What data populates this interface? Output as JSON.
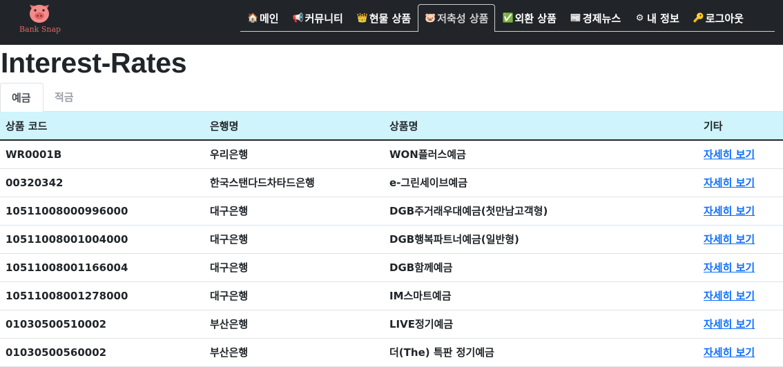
{
  "brand": {
    "name": "Bank Snap",
    "logo_icon": "pig-logo-icon",
    "accent": "#e06565"
  },
  "nav": {
    "items": [
      {
        "label": "메인",
        "icon": "house-icon",
        "active": false
      },
      {
        "label": "커뮤니티",
        "icon": "megaphone-icon",
        "active": false
      },
      {
        "label": "현물 상품",
        "icon": "crown-icon",
        "active": false
      },
      {
        "label": "저축성 상품",
        "icon": "pig-icon",
        "active": true
      },
      {
        "label": "외환 상품",
        "icon": "chart-check-icon",
        "active": false
      },
      {
        "label": "경제뉴스",
        "icon": "newspaper-icon",
        "active": false
      },
      {
        "label": "내 정보",
        "icon": "gear-icon",
        "active": false
      },
      {
        "label": "로그아웃",
        "icon": "key-icon",
        "active": false
      }
    ]
  },
  "page": {
    "title": "Interest-Rates"
  },
  "tabs": [
    {
      "label": "예금",
      "active": true
    },
    {
      "label": "적금",
      "active": false
    }
  ],
  "table": {
    "headers": [
      "상품 코드",
      "은행명",
      "상품명",
      "기타"
    ],
    "rows": [
      {
        "code": "WR0001B",
        "bank": "우리은행",
        "product": "WON플러스예금",
        "action": "자세히 보기"
      },
      {
        "code": "00320342",
        "bank": "한국스탠다드차타드은행",
        "product": "e-그린세이브예금",
        "action": "자세히 보기"
      },
      {
        "code": "10511008000996000",
        "bank": "대구은행",
        "product": "DGB주거래우대예금(첫만남고객형)",
        "action": "자세히 보기"
      },
      {
        "code": "10511008001004000",
        "bank": "대구은행",
        "product": "DGB행복파트너예금(일반형)",
        "action": "자세히 보기"
      },
      {
        "code": "10511008001166004",
        "bank": "대구은행",
        "product": "DGB함께예금",
        "action": "자세히 보기"
      },
      {
        "code": "10511008001278000",
        "bank": "대구은행",
        "product": "IM스마트예금",
        "action": "자세히 보기"
      },
      {
        "code": "01030500510002",
        "bank": "부산은행",
        "product": "LIVE정기예금",
        "action": "자세히 보기"
      },
      {
        "code": "01030500560002",
        "bank": "부산은행",
        "product": "더(The) 특판 정기예금",
        "action": "자세히 보기"
      }
    ]
  },
  "colors": {
    "navbar": "#212529",
    "header_row": "#cff4fc",
    "link": "#0d6efd"
  }
}
